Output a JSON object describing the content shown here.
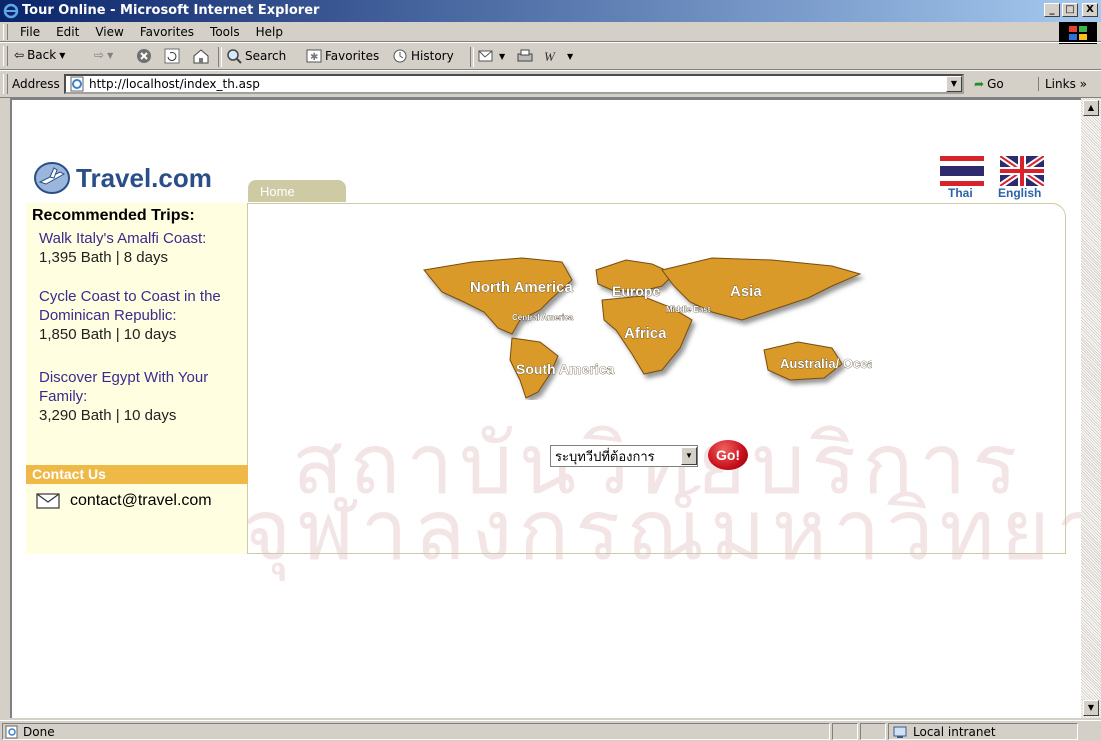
{
  "window": {
    "title": "Tour Online - Microsoft Internet Explorer",
    "buttons": {
      "minimize": "_",
      "maximize": "□",
      "close": "X"
    }
  },
  "menubar": {
    "items": [
      {
        "label": "File",
        "key": "F"
      },
      {
        "label": "Edit",
        "key": "E"
      },
      {
        "label": "View",
        "key": "V"
      },
      {
        "label": "Favorites",
        "key": "a"
      },
      {
        "label": "Tools",
        "key": "T"
      },
      {
        "label": "Help",
        "key": "H"
      }
    ]
  },
  "toolbar": {
    "back": "Back",
    "search": "Search",
    "favorites": "Favorites",
    "history": "History"
  },
  "addressbar": {
    "label": "Address",
    "url": "http://localhost/index_th.asp",
    "go": "Go",
    "links": "Links"
  },
  "page": {
    "logo": "Travel.com",
    "home_tab": "Home",
    "lang_thai": "Thai",
    "lang_english": "English",
    "recommended_title": "Recommended Trips:",
    "trips": [
      {
        "name": "Walk Italy's Amalfi Coast:",
        "meta": "1,395 Bath | 8 days"
      },
      {
        "name": "Cycle Coast to Coast in the Dominican Republic:",
        "meta": "1,850 Bath | 10 days"
      },
      {
        "name": "Discover Egypt With Your Family:",
        "meta": "3,290 Bath | 10 days"
      }
    ],
    "contact_title": "Contact Us",
    "contact_email": "contact@travel.com",
    "map_labels": {
      "north_america": "North America",
      "central_america": "Central America",
      "south_america": "South America",
      "europe": "Europe",
      "middle_east": "Middle East",
      "africa": "Africa",
      "asia": "Asia",
      "australia": "Australia/ Oceania"
    },
    "continent_select": "ระบุทวีปที่ต้องการ",
    "go_button": "Go!"
  },
  "watermark": {
    "line1": "สถาบันวิทยบริการ",
    "line2": "จุฬาลงกรณ์มหาวิทยาลัย"
  },
  "statusbar": {
    "status": "Done",
    "zone": "Local intranet"
  },
  "colors": {
    "accent_gold": "#efb948",
    "tab_khaki": "#cdcaa4",
    "sidebar_cream": "#fffee0",
    "link_purple": "#3b2b8e",
    "brand_blue": "#2a4e88"
  }
}
